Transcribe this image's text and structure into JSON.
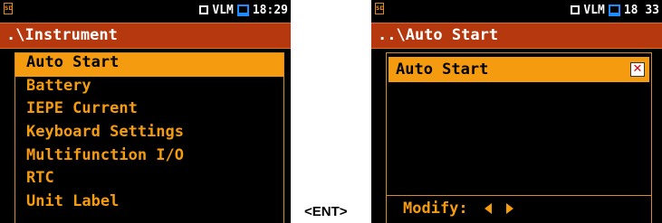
{
  "left_screen": {
    "status": {
      "time": "18:29",
      "indicator": "VLM"
    },
    "title": ".\\Instrument",
    "menu_items": [
      {
        "label": "Auto Start",
        "selected": true
      },
      {
        "label": "Battery"
      },
      {
        "label": "IEPE Current"
      },
      {
        "label": "Keyboard Settings"
      },
      {
        "label": "Multifunction I/O"
      },
      {
        "label": "RTC"
      },
      {
        "label": "Unit Label"
      }
    ]
  },
  "right_screen": {
    "status": {
      "time": "18 33",
      "indicator": "VLM"
    },
    "title": "..\\Auto Start",
    "parameter": {
      "label": "Auto Start",
      "checked": false
    },
    "hint": "Modify:"
  },
  "transition_label": "<ENT>",
  "colors": {
    "title_bar": "#b6380f",
    "menu_text": "#f59b10",
    "highlight": "#f59b10",
    "battery_icon": "#1e8bff",
    "checkbox_x": "#e00000"
  }
}
